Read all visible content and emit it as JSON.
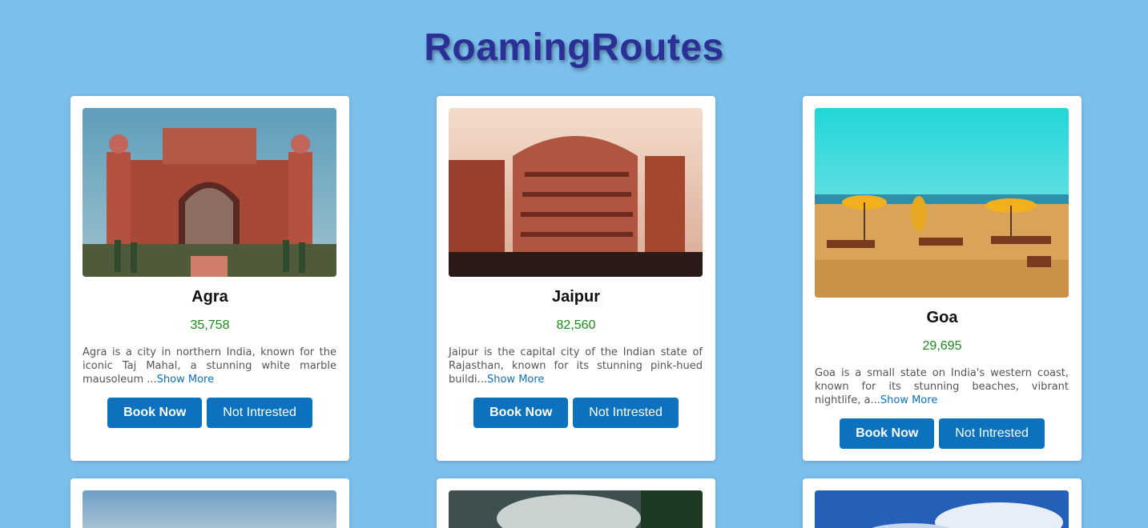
{
  "site": {
    "title": "RoamingRoutes"
  },
  "cards": [
    {
      "name": "Agra",
      "price": "35,758",
      "description": "Agra is a city in northern India, known for the iconic Taj Mahal, a stunning white marble mausoleum ...",
      "show_more": "Show More",
      "book_label": "Book Now",
      "not_interested_label": "Not Intrested"
    },
    {
      "name": "Jaipur",
      "price": "82,560",
      "description": "Jaipur is the capital city of the Indian state of Rajasthan, known for its stunning pink-hued buildi...",
      "show_more": "Show More",
      "book_label": "Book Now",
      "not_interested_label": "Not Intrested"
    },
    {
      "name": "Goa",
      "price": "29,695",
      "description": "Goa is a small state on India's western coast, known for its stunning beaches, vibrant nightlife, a...",
      "show_more": "Show More",
      "book_label": "Book Now",
      "not_interested_label": "Not Intrested"
    }
  ],
  "colors": {
    "background": "#7bbfec",
    "title": "#2b2f96",
    "button": "#0c72bd",
    "price": "#1a8a1a",
    "link": "#0d6fbf"
  }
}
